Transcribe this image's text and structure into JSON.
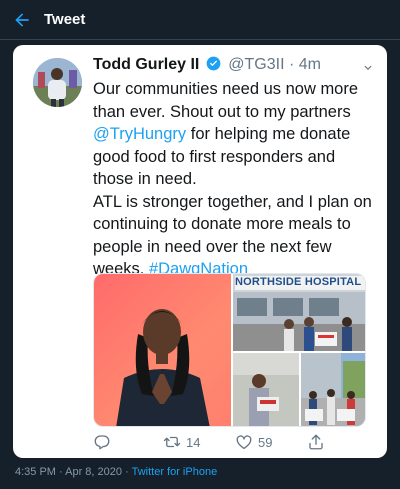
{
  "topbar": {
    "title": "Tweet",
    "back_icon": "back-arrow-icon"
  },
  "tweet": {
    "author_name": "Todd Gurley II",
    "handle": "@TG3II",
    "separator": "·",
    "time": "4m",
    "lines": [
      {
        "pre": "Our communities need us now more than ever. Shout out to my partners ",
        "link": "@TryHungry",
        "post": " for helping me donate good food to first responders and those in need."
      },
      {
        "pre": "ATL is stronger together, and I plan on continuing to donate more meals to people in need over the next few weeks. ",
        "link": "#DawgNation",
        "post": ""
      }
    ],
    "media": {
      "sign_text": "NORTHSIDE HOSPITAL"
    },
    "actions": {
      "reply_count": "",
      "retweet_count": "14",
      "like_count": "59"
    }
  },
  "footer": {
    "timestamp": "4:35 PM · Apr 8, 2020 · ",
    "source": "Twitter for iPhone"
  },
  "colors": {
    "background": "#15202b",
    "card": "#ffffff",
    "link": "#1da1f2",
    "muted": "#657786"
  }
}
